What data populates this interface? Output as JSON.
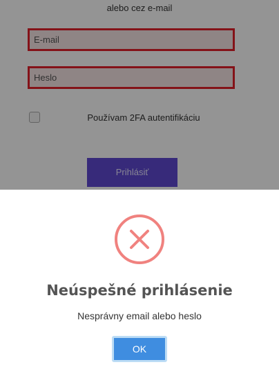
{
  "login": {
    "subtitle": "alebo cez e-mail",
    "email_placeholder": "E-mail",
    "password_placeholder": "Heslo",
    "twofa_label": "Používam 2FA autentifikáciu",
    "submit_label": "Prihlásiť",
    "accent_color": "#5f49d3",
    "error_border_color": "#e3202a"
  },
  "dialog": {
    "icon": "error-x-icon",
    "title": "Neúspešné prihlásenie",
    "message": "Nesprávny email alebo heslo",
    "ok_label": "OK",
    "icon_color": "#f0827f",
    "button_color": "#3f8de0"
  }
}
